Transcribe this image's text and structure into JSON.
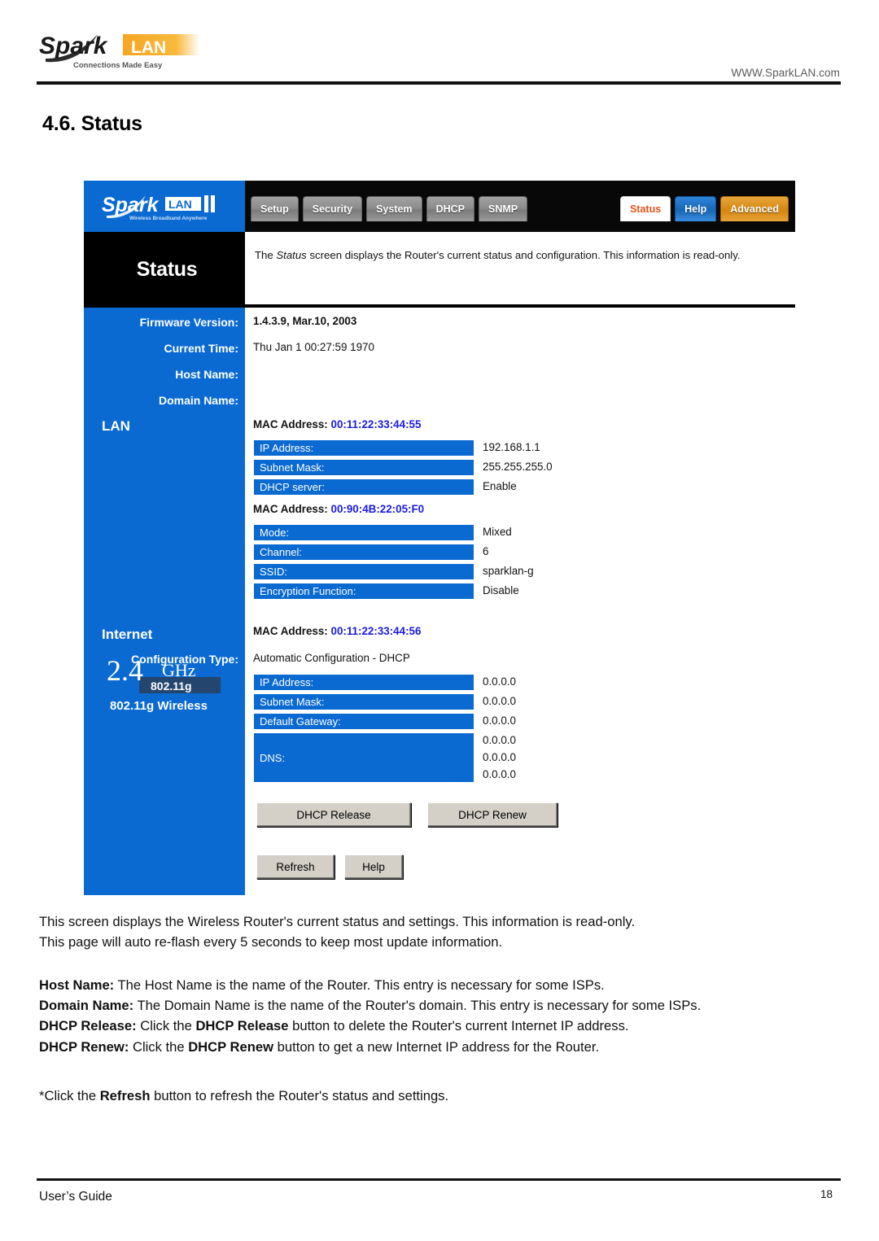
{
  "header": {
    "logo_main": "Spark",
    "logo_accent": "LAN",
    "logo_tagline": "Connections Made Easy",
    "url": "WWW.SparkLAN.com"
  },
  "section": {
    "number_title": "4.6. Status"
  },
  "router_ui": {
    "logo_main": "Spark",
    "logo_accent": "LAN",
    "logo_suffix": "II",
    "logo_tagline": "Wireless Broadband Anywhere",
    "tabs_left": [
      {
        "label": "Setup",
        "state": "normal"
      },
      {
        "label": "Security",
        "state": "normal"
      },
      {
        "label": "System",
        "state": "normal"
      },
      {
        "label": "DHCP",
        "state": "normal"
      },
      {
        "label": "SNMP",
        "state": "normal"
      }
    ],
    "tabs_right": [
      {
        "label": "Status",
        "state": "active"
      },
      {
        "label": "Help",
        "state": "blue"
      },
      {
        "label": "Advanced",
        "state": "orange"
      }
    ],
    "screen_title": "Status",
    "description_pre": "The ",
    "description_em": "Status",
    "description_post": " screen displays the Router's current status and configuration. This information is read-only.",
    "general": [
      {
        "label": "Firmware Version:",
        "value": "1.4.3.9, Mar.10, 2003",
        "bold": true
      },
      {
        "label": "Current Time:",
        "value": "Thu Jan 1 00:27:59 1970",
        "bold": false
      },
      {
        "label": "Host Name:",
        "value": "",
        "bold": false
      },
      {
        "label": "Domain Name:",
        "value": "",
        "bold": false
      }
    ],
    "lan": {
      "heading": "LAN",
      "mac_label": "MAC Address:",
      "mac_value": "00:11:22:33:44:55",
      "rows": [
        {
          "label": "IP Address:",
          "value": "192.168.1.1"
        },
        {
          "label": "Subnet Mask:",
          "value": "255.255.255.0"
        },
        {
          "label": "DHCP server:",
          "value": "Enable"
        }
      ]
    },
    "wireless": {
      "mac_label": "MAC Address:",
      "mac_value": "00:90:4B:22:05:F0",
      "rows": [
        {
          "label": "Mode:",
          "value": "Mixed"
        },
        {
          "label": "Channel:",
          "value": "6"
        },
        {
          "label": "SSID:",
          "value": "sparklan-g"
        },
        {
          "label": "Encryption Function:",
          "value": "Disable"
        }
      ],
      "badge_num": "2.4",
      "badge_unit": "GHz",
      "badge_std": "802.11g",
      "badge_sub": "802.11g Wireless"
    },
    "internet": {
      "heading": "Internet",
      "mac_label": "MAC Address:",
      "mac_value": "00:11:22:33:44:56",
      "config_type_label": "Configuration Type:",
      "config_type_value": "Automatic Configuration - DHCP",
      "rows": [
        {
          "label": "IP Address:",
          "value": "0.0.0.0"
        },
        {
          "label": "Subnet Mask:",
          "value": "0.0.0.0"
        },
        {
          "label": "Default Gateway:",
          "value": "0.0.0.0"
        }
      ],
      "dns_label": "DNS:",
      "dns_values": "0.0.0.0\n0.0.0.0\n0.0.0.0"
    },
    "buttons": {
      "dhcp_release": "DHCP Release",
      "dhcp_renew": "DHCP Renew",
      "refresh": "Refresh",
      "help": "Help"
    }
  },
  "prose": {
    "p1_line1": "This screen displays the Wireless Router's current status and settings. This information is read-only.",
    "p1_line2": "This page will auto re-flash every 5 seconds to keep most update information.",
    "host_name_term": "Host Name:",
    "host_name_text": " The Host Name is the name of the Router. This entry is necessary for some ISPs.",
    "domain_name_term": "Domain Name:",
    "domain_name_text": " The Domain Name is the name of the Router's domain. This entry is necessary for some ISPs.",
    "dhcp_release_term": "DHCP Release:",
    "dhcp_release_text1": " Click the ",
    "dhcp_release_bold": "DHCP Release",
    "dhcp_release_text2": " button to delete the Router's current Internet IP address.",
    "dhcp_renew_term": "DHCP Renew:",
    "dhcp_renew_text1": " Click the ",
    "dhcp_renew_bold": "DHCP Renew",
    "dhcp_renew_text2": " button to get a new Internet IP address for the Router.",
    "refresh_note_pre": "*Click the ",
    "refresh_note_bold": "Refresh",
    "refresh_note_post": " button to refresh the Router's status and settings."
  },
  "footer": {
    "left": "User’s Guide",
    "page_number": "18"
  },
  "colors": {
    "brand_blue": "#0a6ad1",
    "brand_orange": "#f5a623",
    "mac_blue": "#1a1ae0",
    "active_tab_text": "#e8531a"
  }
}
